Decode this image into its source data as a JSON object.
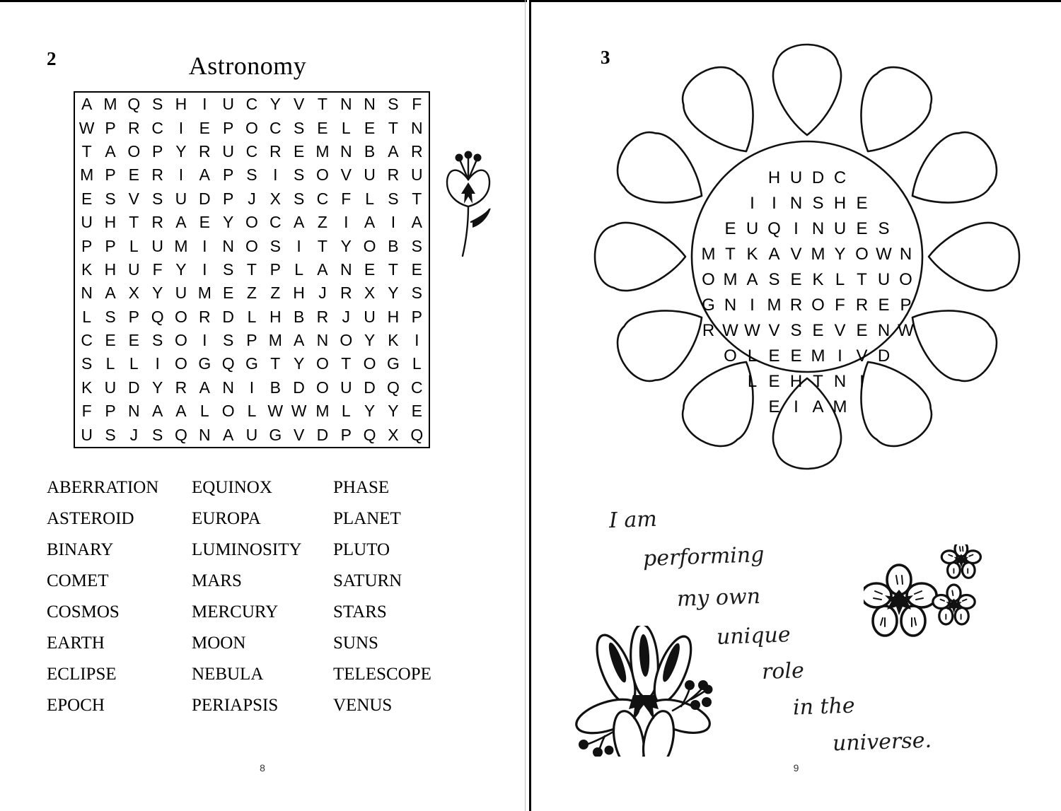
{
  "spread": {
    "left_page": {
      "puzzle_number": "2",
      "title": "Astronomy",
      "folio": "8",
      "grid": {
        "rows": [
          "A M Q S H I U C Y V T N N S F",
          "W P R C I E P O C S E L E T N",
          "T A O P Y R U C R E M N B A R",
          "M P E R I A P S I S O V U R U",
          "E S V S U D P J X S C F L S T",
          "U H T R A E Y O C A Z I A I A",
          "P P L U M I N O S I T Y O B S",
          "K H U F Y I S T P L A N E T E",
          "N A X Y U M E Z Z H J R X Y S",
          "L S P Q O R D L H B R J U H P",
          "C E E S O I S P M A N O Y K I",
          "S L L I O G Q G T Y O T O G L",
          "K U D Y R A N I B D O U D Q C",
          "F P N A A L O L W W M L Y Y E",
          "U S J S Q N A U G V D P Q X Q"
        ]
      },
      "word_list": [
        "ABERRATION",
        "EQUINOX",
        "PHASE",
        "ASTEROID",
        "EUROPA",
        "PLANET",
        "BINARY",
        "LUMINOSITY",
        "PLUTO",
        "COMET",
        "MARS",
        "SATURN",
        "COSMOS",
        "MERCURY",
        "STARS",
        "EARTH",
        "MOON",
        "SUNS",
        "ECLIPSE",
        "NEBULA",
        "TELESCOPE",
        "EPOCH",
        "PERIAPSIS",
        "VENUS"
      ],
      "decoration": "tulip-flower-doodle"
    },
    "right_page": {
      "puzzle_number": "3",
      "folio": "9",
      "circle_grid": {
        "petal_count": 12,
        "rows": [
          "H U D C",
          "I I N S H E",
          "E U Q I N U E S",
          "M T K A V M Y O W N",
          "O M A S E K L T U O",
          "G N I M R O F R E P",
          "R W W V S E V E N W",
          "O L E E M I V D",
          "L E H T N I",
          "E I A M"
        ]
      },
      "quote": {
        "lines": [
          "I am",
          "performing",
          "my own",
          "unique",
          "role",
          "in the",
          "universe."
        ]
      },
      "decorations": [
        "daisy-cluster-doodle",
        "blossom-trio-doodle"
      ]
    }
  }
}
